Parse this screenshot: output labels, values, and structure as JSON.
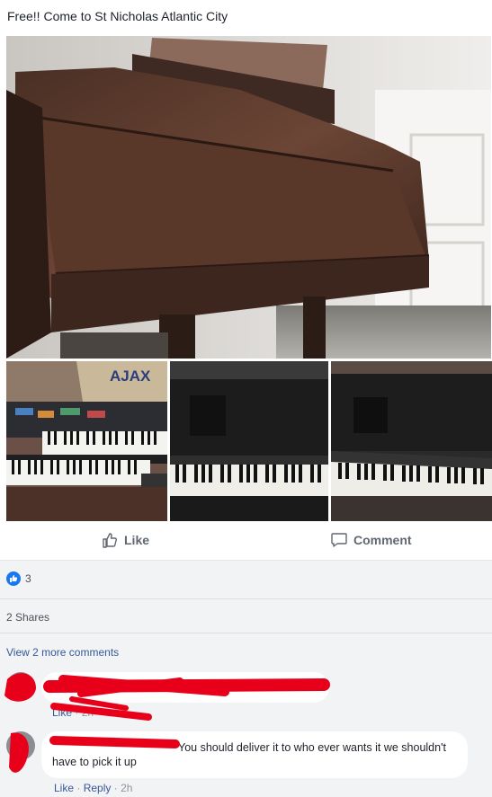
{
  "post": {
    "text": "Free!! Come to St Nicholas Atlantic City"
  },
  "photos": {
    "main_alt": "photo-main",
    "thumb_overlay_text": "AJAX"
  },
  "actions": {
    "like_label": "Like",
    "comment_label": "Comment"
  },
  "feedback": {
    "reaction_count": "3",
    "shares": "2 Shares",
    "view_more": "View 2 more comments"
  },
  "comments": [
    {
      "text": "",
      "meta_like": "Like",
      "meta_time": "2h"
    },
    {
      "text": "You should deliver it to who ever wants it we shouldn't have to pick it up",
      "meta_like": "Like",
      "meta_reply": "Reply",
      "meta_time": "2h"
    }
  ],
  "colors": {
    "accent": "#1877f2",
    "link": "#385898",
    "redaction": "#e8001a"
  }
}
